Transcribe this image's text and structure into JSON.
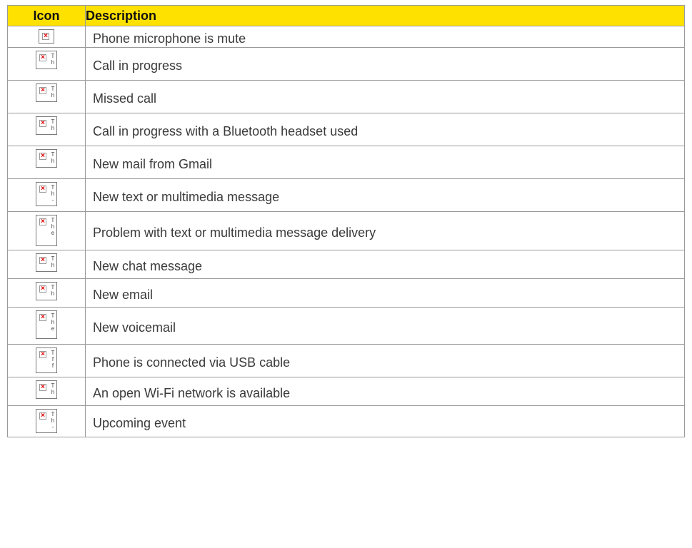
{
  "table": {
    "headers": {
      "icon": "Icon",
      "description": "Description"
    },
    "rows": [
      {
        "icon": "broken-image-icon",
        "alt": [],
        "description": "Phone microphone is mute"
      },
      {
        "icon": "broken-image-icon",
        "alt": [
          "T",
          "h"
        ],
        "description": "Call in progress"
      },
      {
        "icon": "broken-image-icon",
        "alt": [
          "T",
          "h"
        ],
        "description": "Missed call"
      },
      {
        "icon": "broken-image-icon",
        "alt": [
          "T",
          "h"
        ],
        "description": "Call in progress with a Bluetooth headset used"
      },
      {
        "icon": "broken-image-icon",
        "alt": [
          "T",
          "h"
        ],
        "description": "New mail from Gmail"
      },
      {
        "icon": "broken-image-icon",
        "alt": [
          "T",
          "h",
          "-"
        ],
        "description": "New text or multimedia message"
      },
      {
        "icon": "broken-image-icon",
        "alt": [
          "T",
          "h",
          "e"
        ],
        "description": "Problem with text or multimedia message delivery"
      },
      {
        "icon": "broken-image-icon",
        "alt": [
          "T",
          "h"
        ],
        "description": "New chat message"
      },
      {
        "icon": "broken-image-icon",
        "alt": [
          "T",
          "h"
        ],
        "description": "New email"
      },
      {
        "icon": "broken-image-icon",
        "alt": [
          "T",
          "h",
          "e"
        ],
        "description": "New voicemail"
      },
      {
        "icon": "broken-image-icon",
        "alt": [
          "T",
          "f",
          "f"
        ],
        "description": "Phone is connected via USB cable"
      },
      {
        "icon": "broken-image-icon",
        "alt": [
          "T",
          "h"
        ],
        "description": "An open Wi-Fi network is available"
      },
      {
        "icon": "broken-image-icon",
        "alt": [
          "T",
          "h",
          "-"
        ],
        "description": "Upcoming event"
      }
    ]
  },
  "colors": {
    "header_bg": "#ffe100",
    "border": "#9a9a9a",
    "broken_x": "#e00000"
  }
}
